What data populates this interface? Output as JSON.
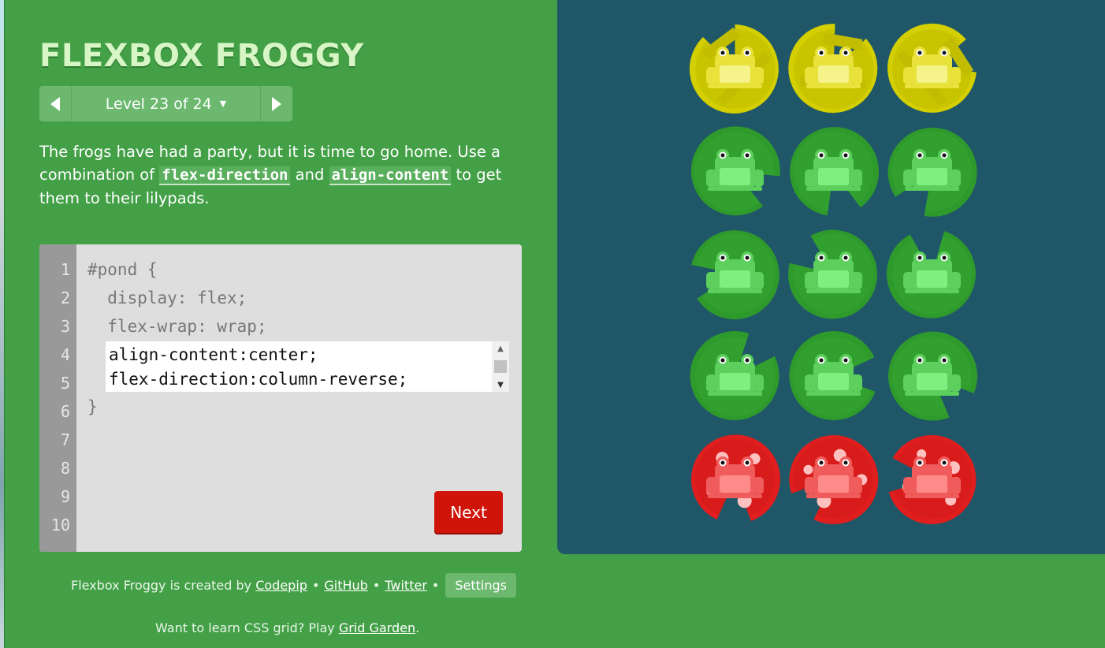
{
  "app": {
    "title": "FLEXBOX FROGGY"
  },
  "level_nav": {
    "label": "Level 23 of 24",
    "prev_icon": "triangle-left-icon",
    "next_icon": "triangle-right-icon",
    "dropdown_icon": "caret-down-icon"
  },
  "instructions": {
    "text_1": "The frogs have had a party, but it is time to go home. Use a combination of ",
    "code_1": "flex-direction",
    "text_2": " and ",
    "code_2": "align-content",
    "text_3": " to get them to their lilypads."
  },
  "editor": {
    "line_numbers": [
      "1",
      "2",
      "3",
      "4",
      "5",
      "6",
      "7",
      "8",
      "9",
      "10"
    ],
    "lines": [
      "#pond {",
      "  display: flex;",
      "  flex-wrap: wrap;",
      "}"
    ],
    "input_lines": [
      "align-content:center;",
      "flex-direction:column-reverse;"
    ],
    "next_label": "Next"
  },
  "footer": {
    "credit_text": "Flexbox Froggy is created by ",
    "codepip": "Codepip",
    "github": "GitHub",
    "twitter": "Twitter",
    "separator": "•",
    "settings_label": "Settings",
    "grid_text": "Want to learn CSS grid? Play ",
    "grid_link": "Grid Garden",
    "grid_end": "."
  },
  "pond": {
    "colors": {
      "yellow": "#d4cf00",
      "green": "#2f9a2c",
      "red": "#e01e1e",
      "background": "#1f5768"
    },
    "rows": [
      [
        "yellow",
        "yellow",
        "yellow"
      ],
      [
        "green",
        "green",
        "green"
      ],
      [
        "green",
        "green",
        "green"
      ],
      [
        "green",
        "green",
        "green"
      ],
      [
        "red",
        "red",
        "red"
      ]
    ]
  }
}
